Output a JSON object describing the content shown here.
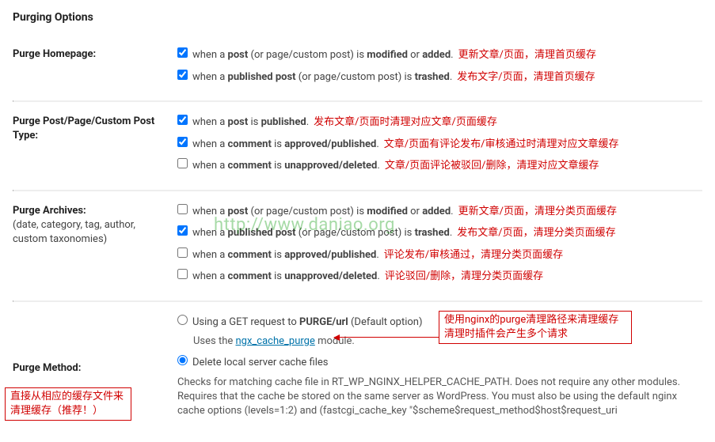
{
  "section_title": "Purging Options",
  "watermark": "http://www.daniao.org",
  "rows": {
    "homepage": {
      "label": "Purge Homepage:",
      "opts": [
        {
          "checked": true,
          "html": "when a <b>post</b> (or page/custom post) is <b>modified</b> or <b>added</b>.",
          "ann": "更新文章/页面，清理首页缓存"
        },
        {
          "checked": true,
          "html": "when a <b>published post</b> (or page/custom post) is <b>trashed</b>.",
          "ann": "发布文字/页面，清理首页缓存"
        }
      ]
    },
    "post": {
      "label": "Purge Post/Page/Custom Post Type:",
      "opts": [
        {
          "checked": true,
          "html": "when a <b>post</b> is <b>published</b>.",
          "ann": "发布文章/页面时清理对应文章/页面缓存"
        },
        {
          "checked": true,
          "html": "when a <b>comment</b> is <b>approved/published</b>.",
          "ann": "文章/页面有评论发布/审核通过时清理对应文章缓存"
        },
        {
          "checked": false,
          "html": "when a <b>comment</b> is <b>unapproved/deleted</b>.",
          "ann": "文章/页面评论被驳回/删除，清理对应文章缓存"
        }
      ]
    },
    "archives": {
      "label": "Purge Archives:",
      "sublabel": "(date, category, tag, author, custom taxonomies)",
      "opts": [
        {
          "checked": false,
          "html": "when a <b>post</b> (or page/custom post) is <b>modified</b> or <b>added</b>.",
          "ann": "更新文章/页面，清理分类页面缓存"
        },
        {
          "checked": true,
          "html": "when a <b>published post</b> (or page/custom post) is <b>trashed</b>.",
          "ann": "发布文章/页面，清理分类页面缓存"
        },
        {
          "checked": false,
          "html": "when a <b>comment</b> is <b>approved/published</b>.",
          "ann": "评论发布/审核通过，清理分类页面缓存"
        },
        {
          "checked": false,
          "html": "when a <b>comment</b> is <b>unapproved/deleted</b>.",
          "ann": "评论驳回/删除，清理分类页面缓存"
        }
      ]
    },
    "method": {
      "label": "Purge Method:",
      "radios": [
        {
          "checked": false,
          "label_prefix": "Using a GET request to ",
          "label_bold": "PURGE/url",
          "label_suffix": " (Default option)",
          "note_prefix": "Uses the ",
          "note_link": "ngx_cache_purge",
          "note_suffix": " module."
        },
        {
          "checked": true,
          "label": "Delete local server cache files",
          "note": "Checks for matching cache file in RT_WP_NGINX_HELPER_CACHE_PATH. Does not require any other modules. Requires that the cache be stored on the same server as WordPress. You must also be using the default nginx cache options (levels=1:2) and (fastcgi_cache_key \"$scheme$request_method$host$request_uri"
        }
      ]
    }
  },
  "ann_box1_line1": "使用nginx的purge清理路径来清理缓存",
  "ann_box1_line2": "清理时插件会产生多个请求",
  "ann_box2_line1": "直接从相应的缓存文件来",
  "ann_box2_line2": "清理缓存（推荐！）"
}
